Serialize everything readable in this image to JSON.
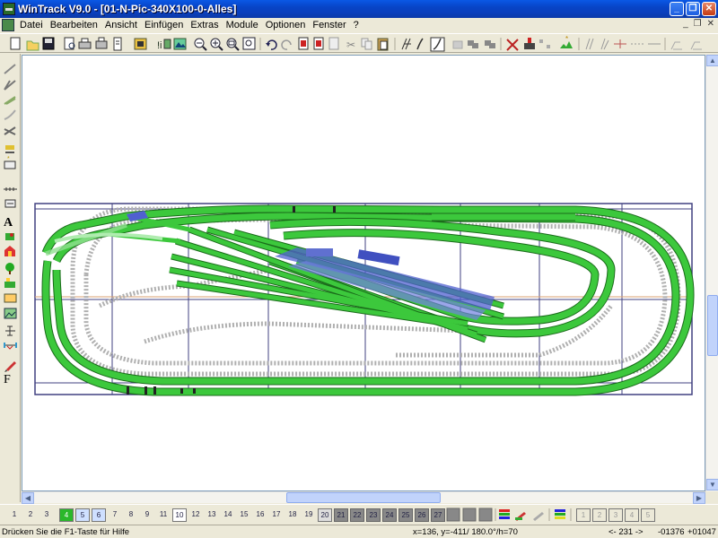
{
  "window": {
    "title": "WinTrack  V9.0 - [01-N-Pic-340X100-0-Alles]",
    "controls": {
      "minimize": "_",
      "maximize": "❐",
      "close": "✕"
    }
  },
  "menu": {
    "items": [
      "Datei",
      "Bearbeiten",
      "Ansicht",
      "Einfügen",
      "Extras",
      "Module",
      "Optionen",
      "Fenster",
      "?"
    ],
    "mdi": {
      "minimize": "_",
      "restore": "❐",
      "close": "✕"
    }
  },
  "toolbar": {
    "icons": [
      "new-icon",
      "open-icon",
      "save-icon",
      "print-preview-icon",
      "print-icon",
      "print-setup-icon",
      "list-icon",
      "library-icon",
      "parts-list-icon",
      "3d-view-icon",
      "zoom-out-icon",
      "zoom-in-icon",
      "zoom-fit-icon",
      "zoom-all-icon",
      "undo-icon",
      "redo-icon",
      "block-icon",
      "copy-block-icon",
      "paste-block-icon",
      "cut-icon",
      "copy-icon",
      "paste-icon",
      "switch-icon",
      "curve-icon",
      "flex-track-icon",
      "align-icon",
      "group-icon",
      "ungroup-icon",
      "measure-icon",
      "signal-icon",
      "connect-icon",
      "landscape-icon",
      "height-icon",
      "turnout-icon",
      "crossing-icon",
      "join-icon",
      "split-icon"
    ]
  },
  "lefttools": {
    "icons": [
      "track-icon",
      "turnout-left-icon",
      "turnout-right-icon",
      "curve-turnout-icon",
      "crossing-icon",
      "buffer-icon",
      "ramp-icon",
      "bridge-icon",
      "text-icon",
      "signal-icon",
      "building-icon",
      "tree-icon",
      "platform-icon",
      "picture-icon",
      "landscape-icon",
      "height-marker-icon",
      "measure-icon",
      "paint-icon",
      "font-icon"
    ],
    "text_label": "A",
    "font_label": "F"
  },
  "layers": {
    "labels": [
      "1",
      "2",
      "3",
      "4",
      "5",
      "6",
      "7",
      "8",
      "9",
      "10",
      "11",
      "12",
      "13",
      "14",
      "15",
      "16",
      "17",
      "18",
      "19",
      "20",
      "21",
      "22",
      "23",
      "24",
      "25",
      "26",
      "27"
    ],
    "active": "10",
    "right_labels": [
      "1",
      "2",
      "3",
      "4",
      "5"
    ]
  },
  "status": {
    "help": "Drücken Sie die  F1-Taste für Hilfe",
    "coords": "x=136, y=-411/ 180.0°/h=70",
    "track_nav": "<- 231 ->",
    "value_a": "-01376",
    "value_b": "+01047"
  },
  "colors": {
    "track_green": "#3cc83c",
    "track_dark": "#1b6b1b",
    "platform_blue": "#5060d0",
    "baseboard_purple": "#404080",
    "title_blue": "#0a58e6"
  }
}
